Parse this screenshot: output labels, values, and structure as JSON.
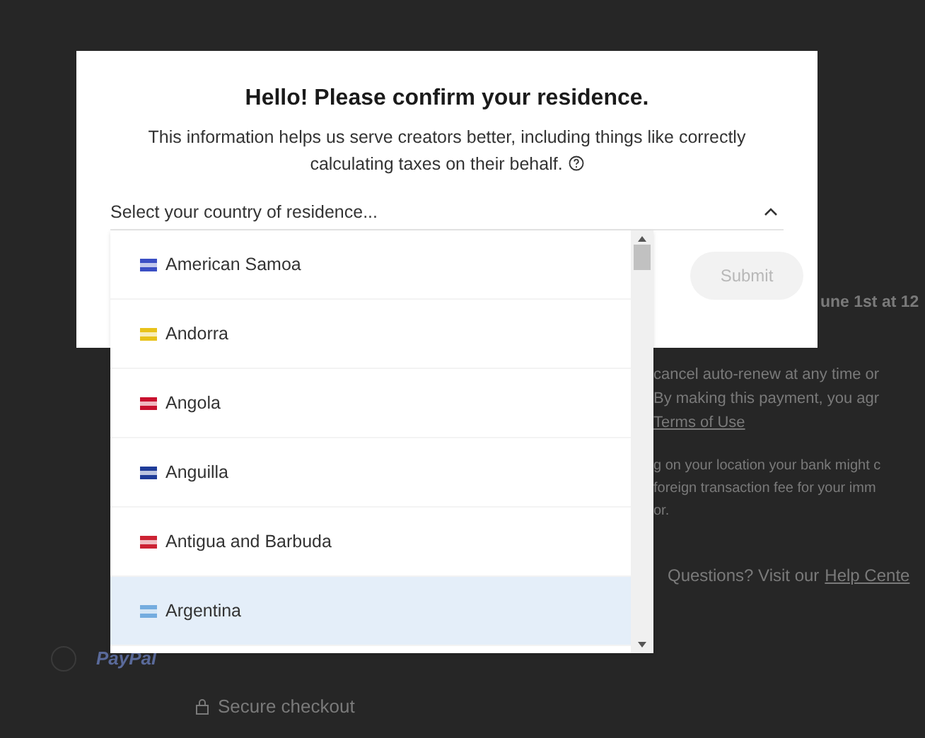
{
  "background": {
    "left": {
      "paypal_selected": false,
      "paypal_label": "PayPal",
      "secure_checkout": "Secure checkout"
    },
    "right": {
      "renewal_date": "une 1st at 12",
      "terms_lines": [
        "cancel auto-renew at any time or",
        "By making this payment, you agr"
      ],
      "terms_link": "Terms of Use",
      "fee_lines": [
        "g on your location your bank might c",
        "foreign transaction fee for your imm",
        "or."
      ],
      "questions": "Questions? Visit our",
      "help_link": "Help Cente"
    }
  },
  "modal": {
    "title": "Hello! Please confirm your residence.",
    "description": "This information helps us serve creators better, including things like correctly calculating taxes on their behalf.",
    "select": {
      "placeholder": "Select your country of residence...",
      "expanded": true
    },
    "submit": {
      "label": "Submit",
      "disabled": true
    }
  },
  "countries": [
    {
      "name": "American Samoa",
      "color": "#3b4fc4",
      "selected": false
    },
    {
      "name": "Andorra",
      "color": "#e8c21a",
      "selected": false
    },
    {
      "name": "Angola",
      "color": "#c8102e",
      "selected": false
    },
    {
      "name": "Anguilla",
      "color": "#1f3c99",
      "selected": false
    },
    {
      "name": "Antigua and Barbuda",
      "color": "#cc2233",
      "selected": false
    },
    {
      "name": "Argentina",
      "color": "#74acdf",
      "selected": true
    }
  ]
}
